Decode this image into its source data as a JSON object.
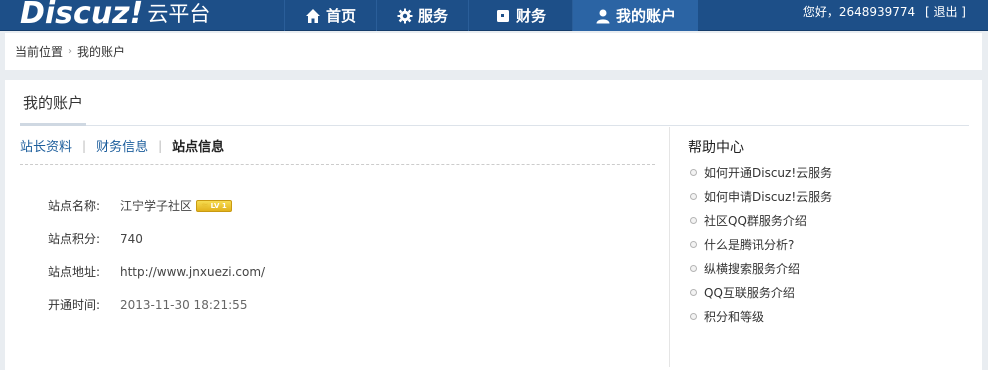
{
  "header": {
    "brand": "Discuz!",
    "subbrand": "云平台",
    "nav": [
      {
        "label": "首页",
        "icon": "home-icon"
      },
      {
        "label": "服务",
        "icon": "gear-icon"
      },
      {
        "label": "财务",
        "icon": "wallet-icon"
      },
      {
        "label": "我的账户",
        "icon": "user-icon",
        "active": true
      }
    ],
    "greeting": "您好，2648939774",
    "logout": "[ 退出 ]"
  },
  "breadcrumb": {
    "prefix": "当前位置",
    "current": "我的账户"
  },
  "main": {
    "title": "我的账户",
    "tabs": [
      {
        "label": "站长资料"
      },
      {
        "label": "财务信息"
      },
      {
        "label": "站点信息",
        "current": true
      }
    ],
    "info": {
      "name_label": "站点名称:",
      "name_value": "江宁学子社区",
      "level_badge": "LV 1",
      "points_label": "站点积分:",
      "points_value": "740",
      "url_label": "站点地址:",
      "url_value": "http://www.jnxuezi.com/",
      "opened_label": "开通时间:",
      "opened_value": "2013-11-30 18:21:55"
    }
  },
  "help": {
    "title": "帮助中心",
    "items": [
      "如何开通Discuz!云服务",
      "如何申请Discuz!云服务",
      "社区QQ群服务介绍",
      "什么是腾讯分析?",
      "纵横搜索服务介绍",
      "QQ互联服务介绍",
      "积分和等级"
    ]
  },
  "colors": {
    "nav_bg": "#1d4f88",
    "nav_active": "#2b64a4",
    "link": "#1d5e9c",
    "page_bg": "#e9edf1"
  }
}
